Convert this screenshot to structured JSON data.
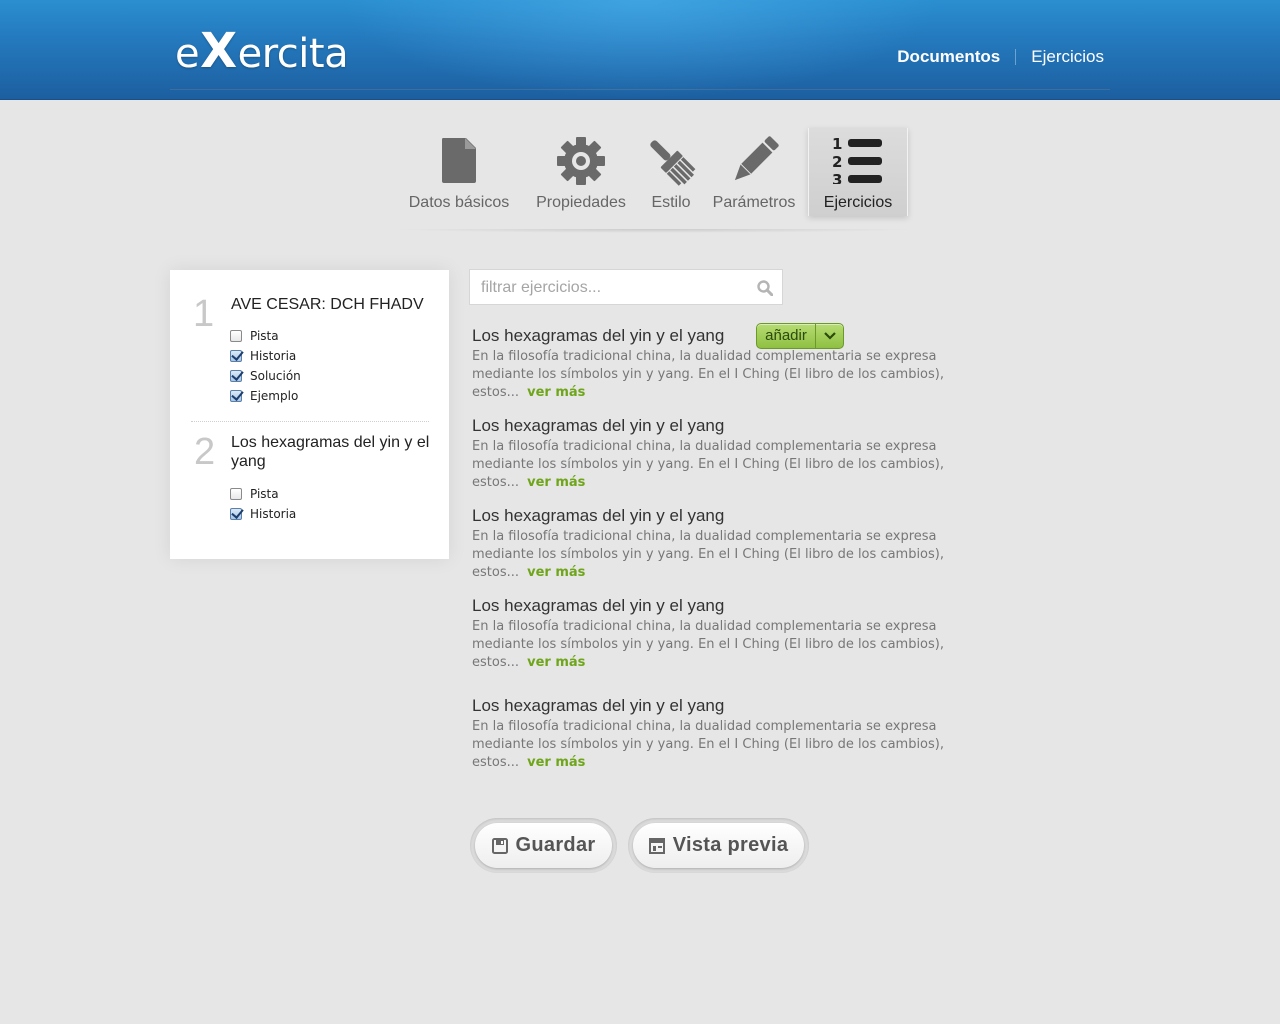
{
  "brand": {
    "logo_pre": "e",
    "logo_x": "X",
    "logo_post": "ercita"
  },
  "topnav": {
    "items": [
      {
        "label": "Documentos",
        "active": true
      },
      {
        "label": "Ejercicios",
        "active": false
      }
    ]
  },
  "toolbar": {
    "tabs": [
      {
        "label": "Datos básicos",
        "icon": "document-icon"
      },
      {
        "label": "Propiedades",
        "icon": "gear-icon"
      },
      {
        "label": "Estilo",
        "icon": "brush-icon"
      },
      {
        "label": "Parámetros",
        "icon": "pencil-icon"
      },
      {
        "label": "Ejercicios",
        "icon": "numbered-list-icon",
        "active": true,
        "list_numbers": [
          "1",
          "2",
          "3"
        ]
      }
    ]
  },
  "selected": {
    "exercises": [
      {
        "number": "1",
        "title": "AVE CESAR: DCH FHADV",
        "options": [
          {
            "label": "Pista",
            "checked": false
          },
          {
            "label": "Historia",
            "checked": true
          },
          {
            "label": "Solución",
            "checked": true
          },
          {
            "label": "Ejemplo",
            "checked": true
          }
        ]
      },
      {
        "number": "2",
        "title": "Los hexagramas del yin y el yang",
        "options": [
          {
            "label": "Pista",
            "checked": false
          },
          {
            "label": "Historia",
            "checked": true
          }
        ]
      }
    ]
  },
  "search": {
    "placeholder": "filtrar ejercicios...",
    "value": ""
  },
  "results": {
    "add_label": "añadir",
    "items": [
      {
        "title": "Los hexagramas del yin y el yang",
        "desc": "En la filosofía tradicional china, la dualidad complementaria se expresa mediante los símbolos yin y yang. En el I Ching (El libro de los cambios), estos...",
        "more": "ver más"
      },
      {
        "title": "Los hexagramas del yin y el yang",
        "desc": "En la filosofía tradicional china, la dualidad complementaria se expresa mediante los símbolos yin y yang. En el I Ching (El libro de los cambios), estos...",
        "more": "ver más"
      },
      {
        "title": "Los hexagramas del yin y el yang",
        "desc": "En la filosofía tradicional china, la dualidad complementaria se expresa mediante los símbolos yin y yang. En el I Ching (El libro de los cambios), estos...",
        "more": "ver más"
      },
      {
        "title": "Los hexagramas del yin y el yang",
        "desc": "En la filosofía tradicional china, la dualidad complementaria se expresa mediante los símbolos yin y yang. En el I Ching (El libro de los cambios), estos...",
        "more": "ver más"
      },
      {
        "title": "Los hexagramas del yin y el yang",
        "desc": "En la filosofía tradicional china, la dualidad complementaria se expresa mediante los símbolos yin y yang. En el I Ching (El libro de los cambios), estos...",
        "more": "ver más"
      }
    ]
  },
  "actions": {
    "save": "Guardar",
    "preview": "Vista previa"
  },
  "colors": {
    "header": "#2479bd",
    "accent_green": "#8fc042",
    "link_green": "#6fa51a",
    "background": "#e6e6e6"
  }
}
